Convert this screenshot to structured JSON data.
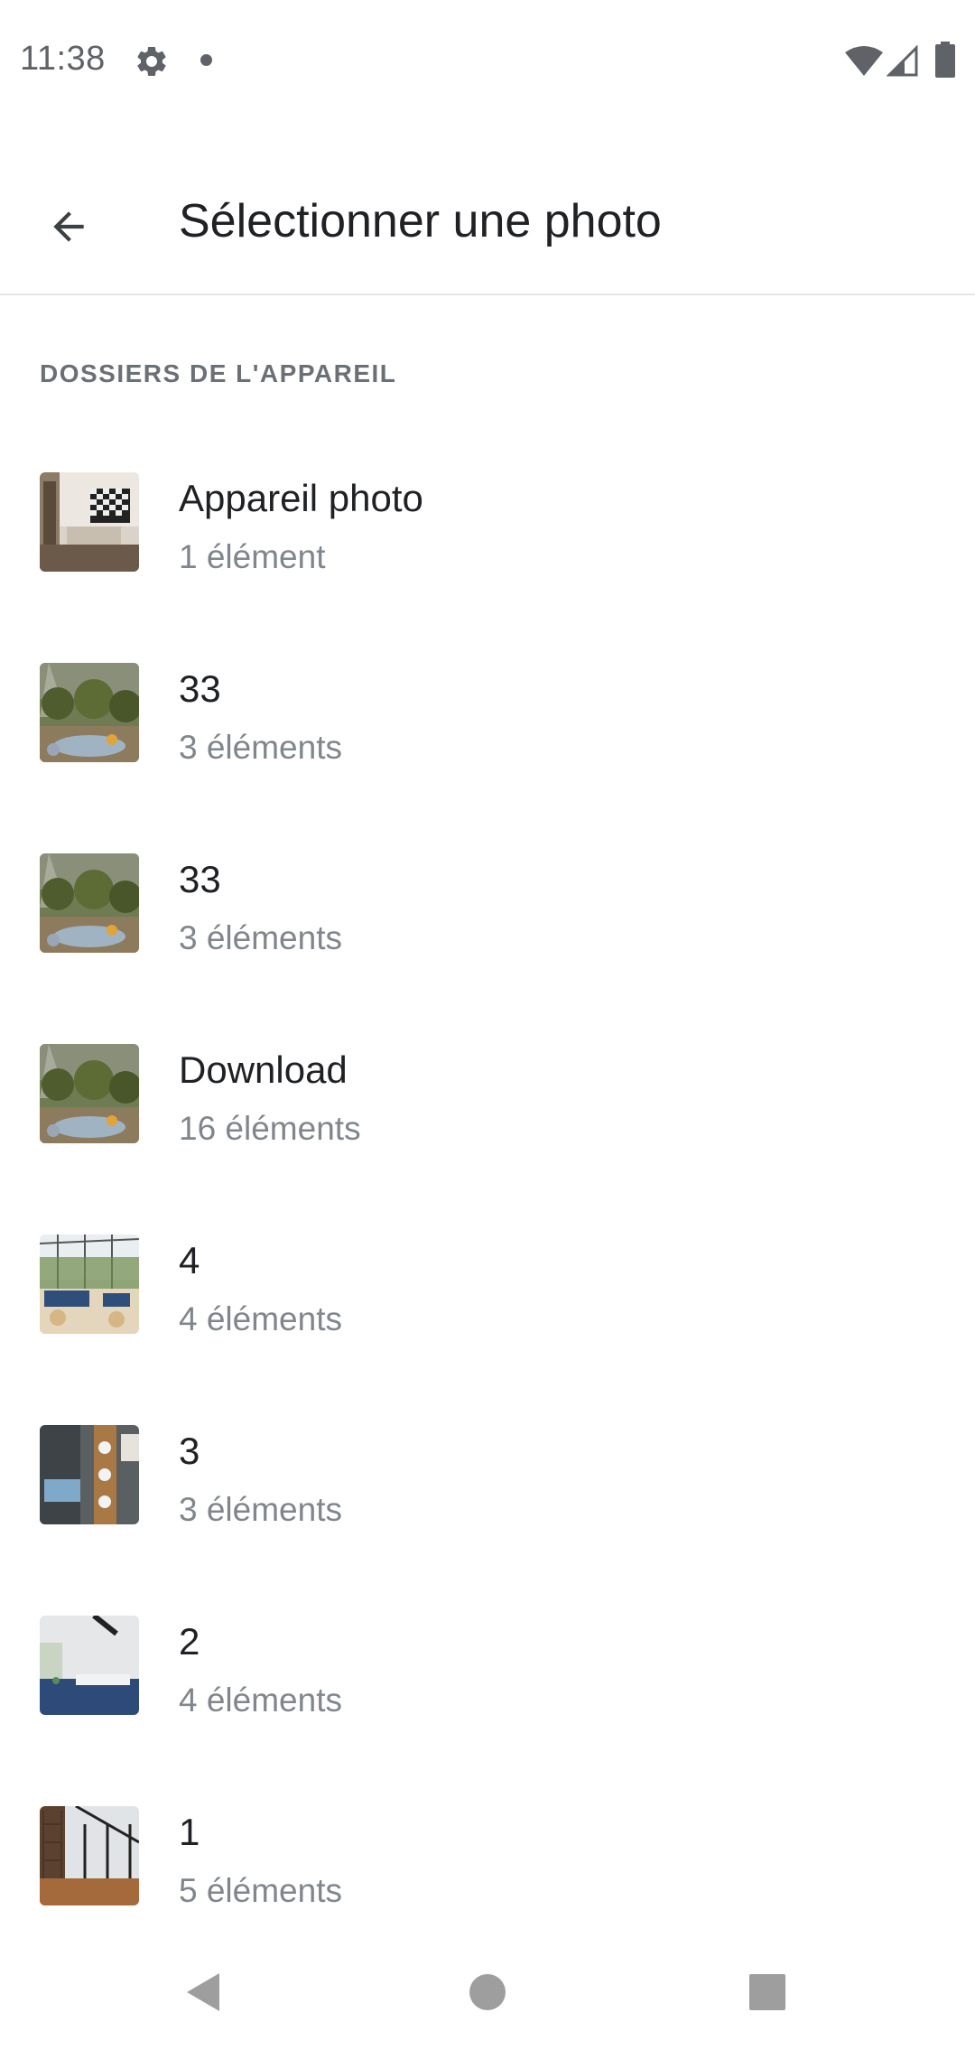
{
  "status_bar": {
    "time": "11:38",
    "icons": [
      "settings-icon",
      "notification-dot-icon",
      "wifi-icon",
      "signal-icon",
      "battery-icon"
    ]
  },
  "app_bar": {
    "back_icon": "arrow-back-icon",
    "title": "Sélectionner une photo"
  },
  "section": {
    "header": "DOSSIERS DE L'APPAREIL"
  },
  "folders": [
    {
      "name": "Appareil photo",
      "count": "1 élément",
      "thumb": "camera-room"
    },
    {
      "name": "33",
      "count": "3 éléments",
      "thumb": "garden"
    },
    {
      "name": "33",
      "count": "3 éléments",
      "thumb": "garden"
    },
    {
      "name": "Download",
      "count": "16 éléments",
      "thumb": "garden"
    },
    {
      "name": "4",
      "count": "4 éléments",
      "thumb": "veranda"
    },
    {
      "name": "3",
      "count": "3 éléments",
      "thumb": "dining"
    },
    {
      "name": "2",
      "count": "4 éléments",
      "thumb": "bedroom"
    },
    {
      "name": "1",
      "count": "5 éléments",
      "thumb": "gym"
    }
  ],
  "nav_bar": {
    "icons": [
      "back-triangle-icon",
      "home-circle-icon",
      "recents-square-icon"
    ]
  },
  "colors": {
    "text_primary": "#202124",
    "text_secondary": "#80868b",
    "section_header": "#6b7076",
    "divider": "#e6e6e6",
    "nav_icons": "#9e9e9e"
  }
}
